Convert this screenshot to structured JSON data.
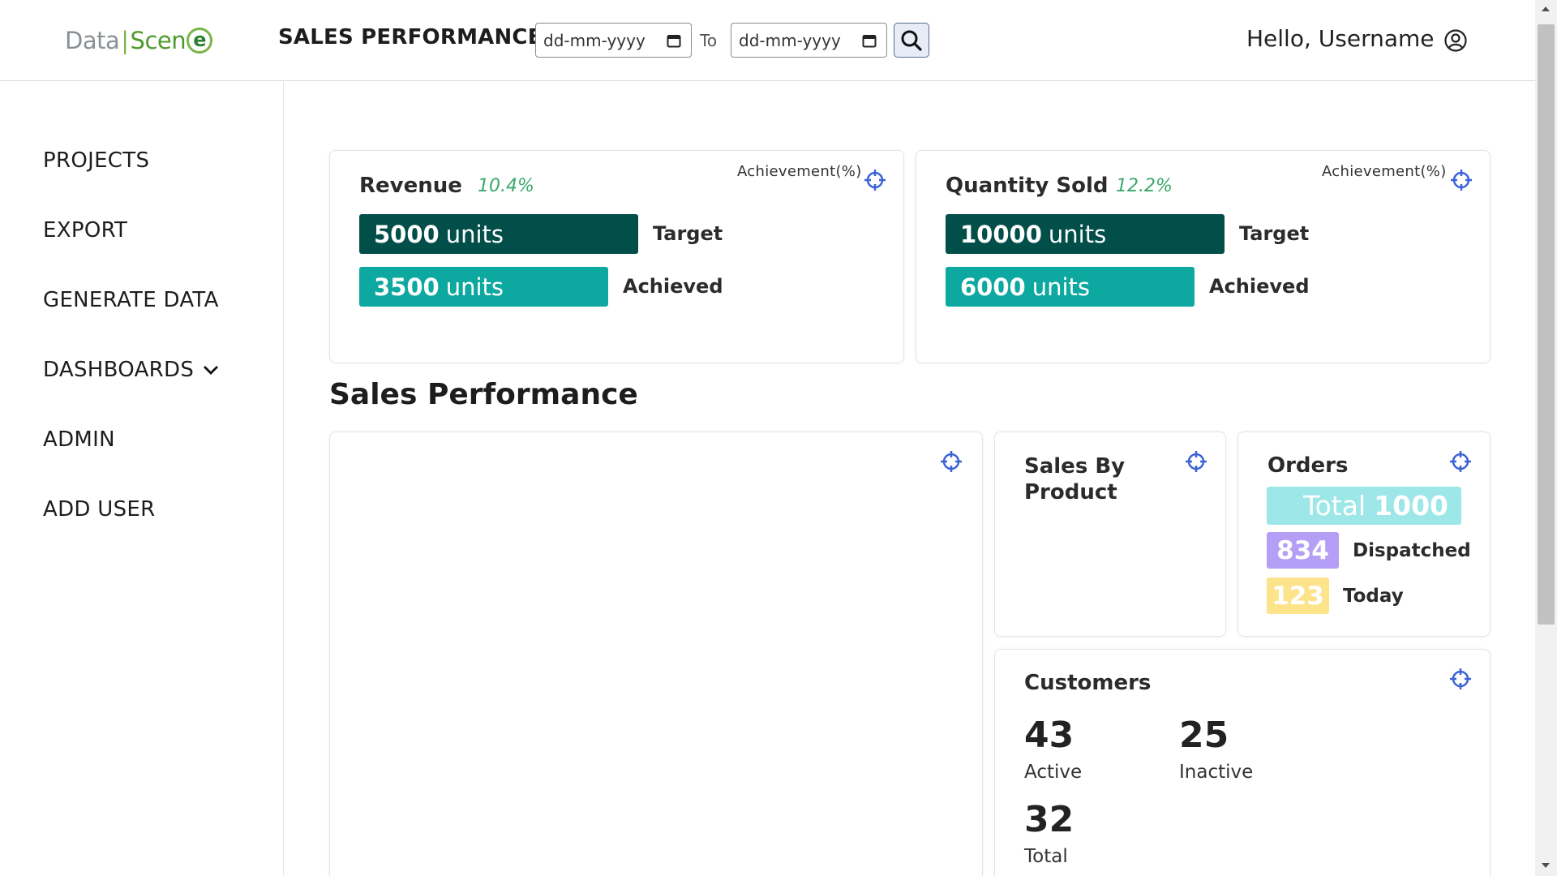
{
  "header": {
    "logo": {
      "part1": "Data",
      "separator": "|",
      "part2": "Scen",
      "part3": "e"
    },
    "title": "SALES PERFORMANCE",
    "date_from_placeholder": "dd-mm-yyyy",
    "to_label": "To",
    "date_to_placeholder": "dd-mm-yyyy",
    "greeting": "Hello, Username"
  },
  "sidebar": {
    "items": [
      {
        "label": "PROJECTS"
      },
      {
        "label": "EXPORT"
      },
      {
        "label": "GENERATE DATA"
      },
      {
        "label": "DASHBOARDS"
      },
      {
        "label": "ADMIN"
      },
      {
        "label": "ADD USER"
      }
    ]
  },
  "revenue": {
    "title": "Revenue",
    "percent": "10.4%",
    "achievement_label": "Achievement(%)",
    "target_value": "5000",
    "target_unit": "units",
    "target_label": "Target",
    "achieved_value": "3500",
    "achieved_unit": "units",
    "achieved_label": "Achieved"
  },
  "quantity": {
    "title": "Quantity Sold",
    "percent": "12.2%",
    "achievement_label": "Achievement(%)",
    "target_value": "10000",
    "target_unit": "units",
    "target_label": "Target",
    "achieved_value": "6000",
    "achieved_unit": "units",
    "achieved_label": "Achieved"
  },
  "section_title": "Sales Performance",
  "sales_by_product": {
    "title_line1": "Sales By",
    "title_line2": "Product"
  },
  "orders": {
    "title": "Orders",
    "total_label": "Total",
    "total_value": "1000",
    "dispatched_value": "834",
    "dispatched_label": "Dispatched",
    "today_value": "123",
    "today_label": "Today"
  },
  "customers": {
    "title": "Customers",
    "active_value": "43",
    "active_label": "Active",
    "inactive_value": "25",
    "inactive_label": "Inactive",
    "total_value": "32",
    "total_label": "Total"
  },
  "colors": {
    "target_bar": "#024f4a",
    "achieved_bar": "#0da8a0",
    "percent_text": "#3aa86b",
    "icon_blue": "#3b63d6",
    "orders_total": "#9ee7e8",
    "orders_dispatched": "#b49ef6",
    "orders_today": "#fde38a"
  },
  "icons": {
    "search": "search-icon",
    "user": "user-circle-icon",
    "calendar": "calendar-icon",
    "target": "crosshair-icon",
    "chevron": "chevron-down-icon"
  }
}
